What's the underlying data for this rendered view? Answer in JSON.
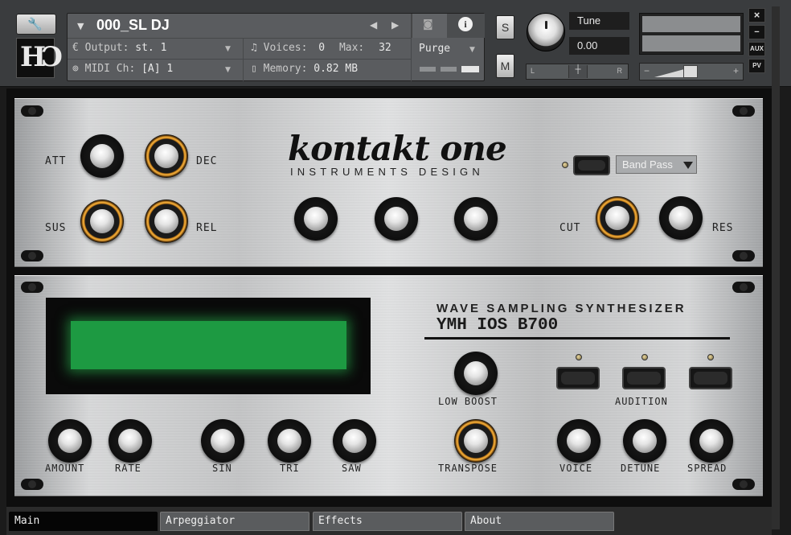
{
  "header": {
    "logo_text": "HƆ",
    "instrument_name": "000_SL DJ",
    "output_label": "Output:",
    "output_value": "st. 1",
    "voices_label": "Voices:",
    "voices_value": "0",
    "max_label": "Max:",
    "max_value": "32",
    "midi_label": "MIDI Ch:",
    "midi_value": "[A]  1",
    "memory_label": "Memory:",
    "memory_value": "0.82 MB",
    "purge_label": "Purge",
    "solo_label": "S",
    "mute_label": "M",
    "tune_label": "Tune",
    "tune_value": "0.00",
    "pan_left": "L",
    "pan_right": "R",
    "vol_minus": "−",
    "vol_plus": "+",
    "aux_label": "AUX",
    "pv_label": "PV",
    "close_label": "×",
    "minimize_label": "−"
  },
  "panel_top": {
    "logo": "kontakt one",
    "logo_sub": "INSTRUMENTS DESIGN",
    "knob_labels": {
      "att": "ATT",
      "dec": "DEC",
      "sus": "SUS",
      "rel": "REL",
      "cut": "CUT",
      "res": "RES"
    },
    "filter_type": "Band Pass"
  },
  "panel_bottom": {
    "synth_title": "WAVE SAMPLING SYNTHESIZER",
    "synth_model": "YMH IOS B700",
    "labels": {
      "low_boost": "LOW BOOST",
      "audition": "AUDITION",
      "amount": "AMOUNT",
      "rate": "RATE",
      "sin": "SIN",
      "tri": "TRI",
      "saw": "SAW",
      "transpose": "TRANSPOSE",
      "voice": "VOICE",
      "detune": "DETUNE",
      "spread": "SPREAD"
    }
  },
  "tabs": [
    "Main",
    "Arpeggiator",
    "Effects",
    "About"
  ],
  "colors": {
    "lcd": "#1d9a42",
    "knob_ring": "#f3b13e"
  }
}
